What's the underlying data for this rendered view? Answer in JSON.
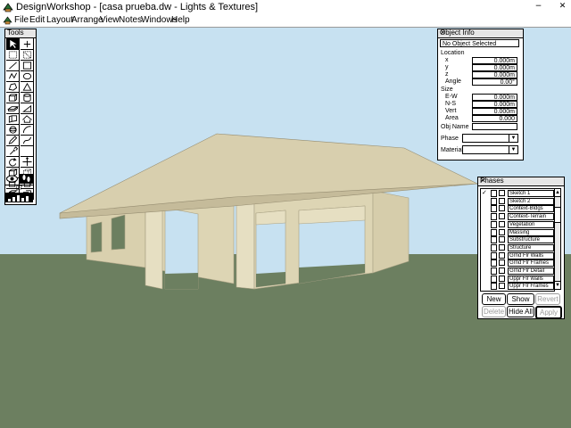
{
  "window": {
    "title": "DesignWorkshop - [casa prueba.dw - Lights & Textures]",
    "app_icon": "designworkshop-logo-icon",
    "minimize_glyph": "−",
    "close_glyph": "✕"
  },
  "menu": {
    "items": [
      "File",
      "Edit",
      "Layout",
      "Arrange",
      "View",
      "Notes",
      "Windows",
      "Help"
    ]
  },
  "scene": {
    "colors": {
      "sky": "#c7e1f1",
      "ground": "#6c7f60",
      "wall": "#ddd5b4",
      "roof_top": "#d8cfae",
      "roof_underside": "#c5bb9a"
    }
  },
  "tools": {
    "title": "Tools",
    "zoom_value": "07",
    "items": [
      "pointer",
      "crosshair",
      "dotted-grid",
      "dotted-grid-2",
      "line",
      "rectangle",
      "polyline",
      "ellipse",
      "polygon",
      "triangle",
      "box",
      "cylinder",
      "slab",
      "wedge",
      "wall",
      "roof",
      "sphere",
      "arc",
      "pen",
      "curve",
      "dropper",
      "blank",
      "rotate",
      "move",
      "cube-a",
      "cube-b",
      "cube-c",
      "cube-d",
      "cube-e",
      "cube-f"
    ]
  },
  "object_info": {
    "title": "Object Info",
    "status": "No Object Selected",
    "location_label": "Location",
    "fields": [
      {
        "label": "x",
        "value": "0.000m"
      },
      {
        "label": "y",
        "value": "0.000m"
      },
      {
        "label": "z",
        "value": "0.000m"
      },
      {
        "label": "Angle",
        "value": "0.00°"
      }
    ],
    "size_label": "Size",
    "size_fields": [
      {
        "label": "E-W",
        "value": "0.000m"
      },
      {
        "label": "N-S",
        "value": "0.000m"
      },
      {
        "label": "Vert",
        "value": "0.000m"
      },
      {
        "label": "Area",
        "value": "0.000"
      }
    ],
    "obj_name_label": "Obj Name",
    "obj_name_value": "",
    "phase_label": "Phase",
    "phase_value": "",
    "material_label": "Material",
    "material_value": ""
  },
  "phases": {
    "title": "Phases",
    "rows": [
      {
        "name": "Sketch 1",
        "checked": true
      },
      {
        "name": "Sketch 2",
        "checked": false
      },
      {
        "name": "Context-Bldgs",
        "checked": false
      },
      {
        "name": "Context-Terrain",
        "checked": false
      },
      {
        "name": "Vegetation",
        "checked": false
      },
      {
        "name": "Massing",
        "checked": false
      },
      {
        "name": "Substructure",
        "checked": false
      },
      {
        "name": "Structure",
        "checked": false
      },
      {
        "name": "Grnd Flr Walls",
        "checked": false
      },
      {
        "name": "Grnd Flr Frames",
        "checked": false
      },
      {
        "name": "Grnd Flr Detail",
        "checked": false
      },
      {
        "name": "Uppr Flr Walls",
        "checked": false
      },
      {
        "name": "Uppr Flr Frames",
        "checked": false
      }
    ],
    "buttons": {
      "new": "New",
      "show_all": "Show All",
      "revert": "Revert",
      "delete": "Delete",
      "hide_all": "Hide All",
      "apply": "Apply"
    }
  }
}
